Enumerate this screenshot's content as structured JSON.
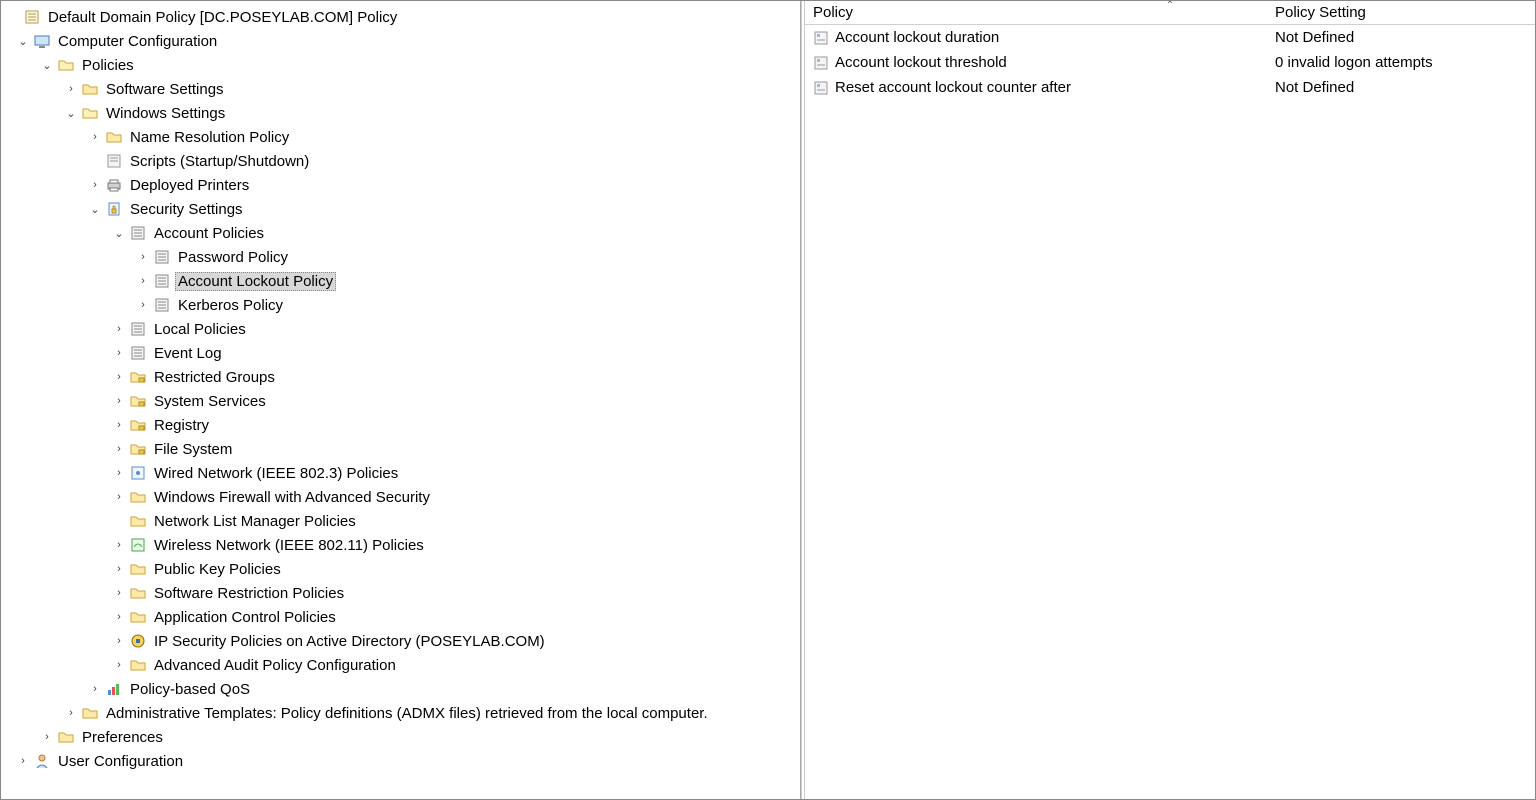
{
  "left": {
    "root": "Default Domain Policy [DC.POSEYLAB.COM] Policy",
    "computerConfig": "Computer Configuration",
    "policies": "Policies",
    "softwareSettings": "Software Settings",
    "windowsSettings": "Windows Settings",
    "nameResolution": "Name Resolution Policy",
    "scripts": "Scripts (Startup/Shutdown)",
    "deployedPrinters": "Deployed Printers",
    "securitySettings": "Security Settings",
    "accountPolicies": "Account Policies",
    "passwordPolicy": "Password Policy",
    "accountLockoutPolicy": "Account Lockout Policy",
    "kerberosPolicy": "Kerberos Policy",
    "localPolicies": "Local Policies",
    "eventLog": "Event Log",
    "restrictedGroups": "Restricted Groups",
    "systemServices": "System Services",
    "registry": "Registry",
    "fileSystem": "File System",
    "wiredNetwork": "Wired Network (IEEE 802.3) Policies",
    "windowsFirewall": "Windows Firewall with Advanced Security",
    "networkListManager": "Network List Manager Policies",
    "wirelessNetwork": "Wireless Network (IEEE 802.11) Policies",
    "publicKey": "Public Key Policies",
    "softwareRestriction": "Software Restriction Policies",
    "applicationControl": "Application Control Policies",
    "ipSecurity": "IP Security Policies on Active Directory (POSEYLAB.COM)",
    "advancedAudit": "Advanced Audit Policy Configuration",
    "policyQoS": "Policy-based QoS",
    "adminTemplates": "Administrative Templates: Policy definitions (ADMX files) retrieved from the local computer.",
    "preferences": "Preferences",
    "userConfig": "User Configuration"
  },
  "right": {
    "headers": {
      "policy": "Policy",
      "setting": "Policy Setting"
    },
    "rows": [
      {
        "name": "Account lockout duration",
        "setting": "Not Defined"
      },
      {
        "name": "Account lockout threshold",
        "setting": "0 invalid logon attempts"
      },
      {
        "name": "Reset account lockout counter after",
        "setting": "Not Defined"
      }
    ]
  }
}
